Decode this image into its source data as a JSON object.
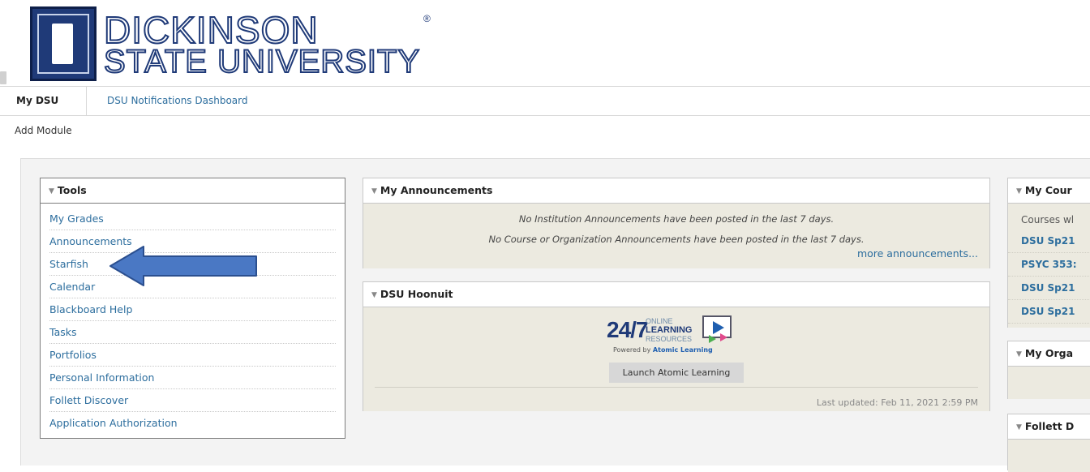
{
  "branding": {
    "line1": "DICKINSON",
    "line2": "STATE UNIVERSITY",
    "registered": "®"
  },
  "tabs": [
    {
      "label": "My DSU",
      "active": true
    },
    {
      "label": "DSU Notifications Dashboard",
      "active": false
    }
  ],
  "add_module": "Add Module",
  "tools": {
    "title": "Tools",
    "items": [
      "My Grades",
      "Announcements",
      "Starfish",
      "Calendar",
      "Blackboard Help",
      "Tasks",
      "Portfolios",
      "Personal Information",
      "Follett Discover",
      "Application Authorization"
    ]
  },
  "announcements": {
    "title": "My Announcements",
    "line1": "No Institution Announcements have been posted in the last 7 days.",
    "line2": "No Course or Organization Announcements have been posted in the last 7 days.",
    "more": "more announcements..."
  },
  "hoonuit": {
    "title": "DSU Hoonuit",
    "logo_247": "24/7",
    "logo_online": "ONLINE",
    "logo_learning": "LEARNING",
    "logo_resources": "RESOURCES",
    "logo_powered_prefix": "Powered by ",
    "logo_powered_brand": "Atomic Learning",
    "launch_label": "Launch Atomic Learning",
    "last_updated": "Last updated: Feb 11, 2021 2:59 PM"
  },
  "courses": {
    "title": "My Cour",
    "note": "Courses wl",
    "items": [
      "DSU Sp21",
      "PSYC 353:",
      "DSU Sp21",
      "DSU Sp21"
    ]
  },
  "organizations": {
    "title": "My Orga"
  },
  "follett": {
    "title": "Follett D"
  },
  "colors": {
    "brand_navy": "#1f3a78",
    "link_blue": "#2d6e9e",
    "module_body": "#eceae0",
    "arrow_fill": "#4a78c4"
  }
}
